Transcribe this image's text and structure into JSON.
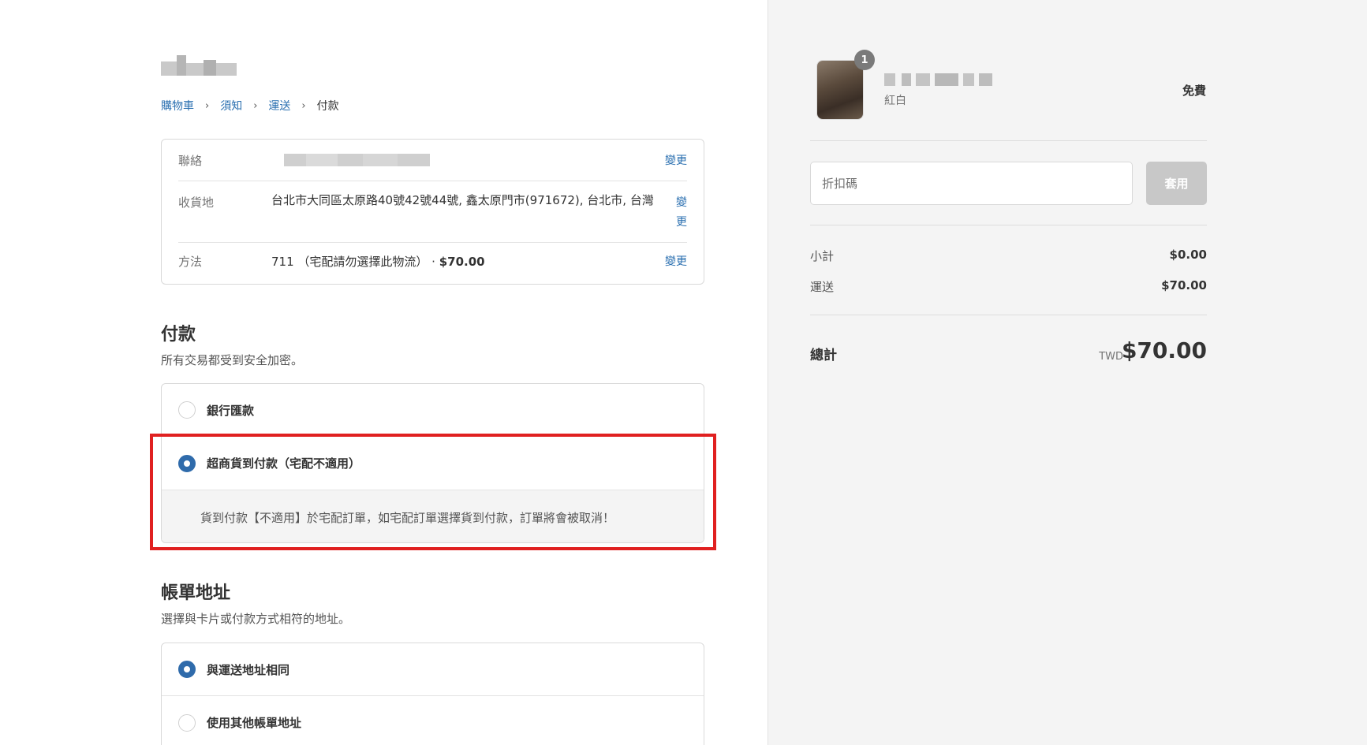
{
  "breadcrumb": {
    "items": [
      "購物車",
      "須知",
      "運送"
    ],
    "current": "付款",
    "separator": "›"
  },
  "review": {
    "contact_label": "聯絡",
    "address_label": "收貨地",
    "address_value": "台北市大同區太原路40號42號44號, 鑫太原門市(971672), 台北市, 台灣",
    "method_label": "方法",
    "method_value": "711 （宅配請勿選擇此物流）",
    "method_dot": " · ",
    "method_price": "$70.00",
    "change_label": "變更"
  },
  "payment": {
    "title": "付款",
    "subtitle": "所有交易都受到安全加密。",
    "options": [
      {
        "label": "銀行匯款",
        "selected": false
      },
      {
        "label": "超商貨到付款（宅配不適用）",
        "selected": true
      }
    ],
    "cod_info": "貨到付款【不適用】於宅配訂單，如宅配訂單選擇貨到付款，訂單將會被取消！"
  },
  "billing": {
    "title": "帳單地址",
    "subtitle": "選擇與卡片或付款方式相符的地址。",
    "options": [
      {
        "label": "與運送地址相同",
        "selected": true
      },
      {
        "label": "使用其他帳單地址",
        "selected": false
      }
    ]
  },
  "summary": {
    "item_quantity": "1",
    "item_variant": "紅白",
    "item_price": "免費",
    "discount_placeholder": "折扣碼",
    "apply_label": "套用",
    "subtotal_label": "小計",
    "subtotal_value": "$0.00",
    "shipping_label": "運送",
    "shipping_value": "$70.00",
    "total_label": "總計",
    "total_currency": "TWD",
    "total_value": "$70.00"
  },
  "colors": {
    "link": "#2a6fb0",
    "radio_selected": "#2f6bab",
    "highlight": "#e02020",
    "sidebar_bg": "#f4f4f4"
  }
}
